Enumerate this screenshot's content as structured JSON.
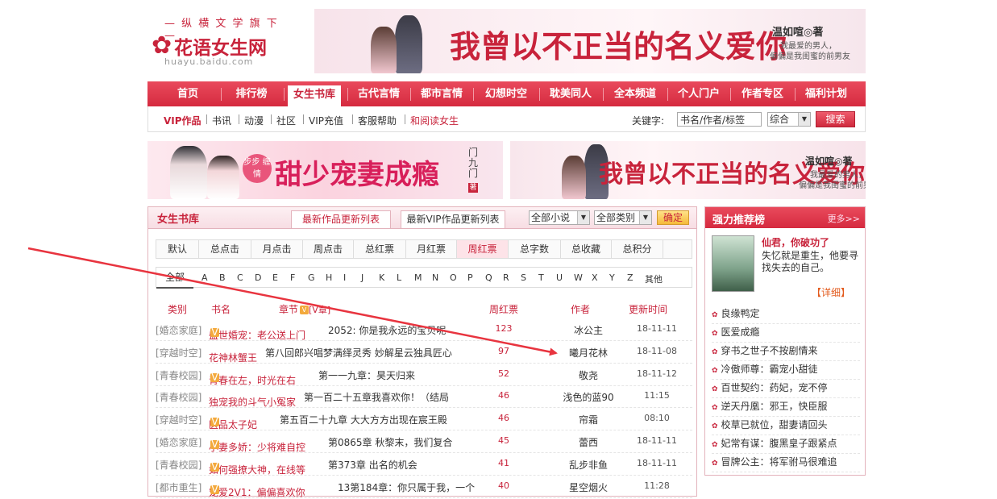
{
  "header": {
    "logo_tagline": "— 纵 横 文 学 旗 下 —",
    "logo_name": "花语女生网",
    "logo_url": "huayu.baidu.com",
    "banner_top": {
      "title": "我曾以不正当的名义爱你",
      "author": "温如喧◎著",
      "sub1": "我最爱的男人，",
      "sub2": "偏偏是我闺蜜的前男友"
    }
  },
  "nav": {
    "items": [
      "首页",
      "排行榜",
      "女生书库",
      "古代言情",
      "都市言情",
      "幻想时空",
      "耽美同人",
      "全本频道",
      "个人门户",
      "作者专区",
      "福利计划"
    ],
    "active_index": 2
  },
  "subnav": {
    "links": [
      "VIP作品",
      "书讯",
      "动漫",
      "社区",
      "VIP充值",
      "客服帮助",
      "和阅读女生"
    ],
    "keyword_label": "关键字:",
    "search_placeholder": "书名/作者/标签",
    "search_type": "综合",
    "search_button": "搜索"
  },
  "banners": {
    "left": {
      "title": "甜少宠妻成瘾",
      "badge": "步步 缠情",
      "side_text": "门九门",
      "stamp": "著"
    },
    "right": {
      "title": "我曾以不正当的名义爱你",
      "author": "温如喧◎著",
      "sub1": "我最爱的男人，",
      "sub2": "偏偏是我闺蜜的前男友"
    }
  },
  "library": {
    "title": "女生书库",
    "tab1": "最新作品更新列表",
    "tab2": "最新VIP作品更新列表",
    "filter_novel": "全部小说",
    "filter_category": "全部类别",
    "confirm": "确定",
    "rank_tabs": [
      "默认",
      "总点击",
      "月点击",
      "周点击",
      "总红票",
      "月红票",
      "周红票",
      "总字数",
      "总收藏",
      "总积分"
    ],
    "active_rank": 6,
    "letters_all": "全部",
    "letters": [
      "A",
      "B",
      "C",
      "D",
      "E",
      "F",
      "G",
      "H",
      "I",
      "J",
      "K",
      "L",
      "M",
      "N",
      "O",
      "P",
      "Q",
      "R",
      "S",
      "T",
      "U",
      "W",
      "X",
      "Y",
      "Z",
      "其他"
    ],
    "columns": {
      "category": "类别",
      "book": "书名",
      "chapter": "章节",
      "chapter_vip": "V",
      "chapter_vip_label": "[V章]",
      "votes": "周红票",
      "author": "作者",
      "updated": "更新时间"
    },
    "rows": [
      {
        "category": "[婚恋家庭]",
        "book": "盛世婚宠：老公送上门",
        "vip": true,
        "chapter": "2052: 你是我永远的宝贝呢",
        "votes": "123",
        "author": "冰公主",
        "updated": "18-11-11"
      },
      {
        "category": "[穿越时空]",
        "book": "花神林蟹王",
        "vip": false,
        "chapter": "第八回郎兴唱梦满绎灵秀 妙解星云独具匠心",
        "votes": "97",
        "author": "曦月花林",
        "updated": "18-11-08"
      },
      {
        "category": "[青春校园]",
        "book": "青春在左，时光在右",
        "vip": true,
        "chapter": "第一一九章：昊天归来",
        "votes": "52",
        "author": "敬尧",
        "updated": "18-11-12"
      },
      {
        "category": "[青春校园]",
        "book": "独宠我的斗气小冤家",
        "vip": false,
        "chapter": "第一百二十五章我喜欢你！（结局",
        "votes": "46",
        "author": "浅色的蓝90",
        "updated": "11:15"
      },
      {
        "category": "[穿越时空]",
        "book": "医品太子妃",
        "vip": true,
        "chapter": "第五百二十九章 大大方方出现在宸王殿",
        "votes": "46",
        "author": "帘霜",
        "updated": "08:10"
      },
      {
        "category": "[婚恋家庭]",
        "book": "小妻多娇：少将难自控",
        "vip": true,
        "chapter": "第0865章 秋黎末，我们复合",
        "votes": "45",
        "author": "蕾西",
        "updated": "18-11-11"
      },
      {
        "category": "[青春校园]",
        "book": "如何强撩大神，在线等",
        "vip": true,
        "chapter": "第373章 出名的机会",
        "votes": "41",
        "author": "乱步非鱼",
        "updated": "18-11-11"
      },
      {
        "category": "[都市重生]",
        "book": "宠爱2V1：偏偏喜欢你",
        "vip": true,
        "chapter": "13第184章：你只属于我，一个",
        "votes": "40",
        "author": "星空烟火",
        "updated": "11:28"
      }
    ]
  },
  "side": {
    "title": "强力推荐榜",
    "more": "更多>>",
    "featured_book": "仙君，你破功了",
    "featured_desc": "失忆就是重生，他要寻找失去的自己。",
    "detail": "【详细】",
    "items": [
      "良缘鸭定",
      "医爱成瘾",
      "穿书之世子不按剧情来",
      "冷傲师尊：霸宠小甜徒",
      "百世契约：药妃，宠不停",
      "逆天丹凰：邪王，快臣服",
      "校草已就位，甜妻请回头",
      "妃常有谋：腹黑皇子跟紧点",
      "冒牌公主：将军驸马很难追"
    ]
  },
  "colors": {
    "brand": "#c8233b",
    "arrow": "#e8343f"
  }
}
